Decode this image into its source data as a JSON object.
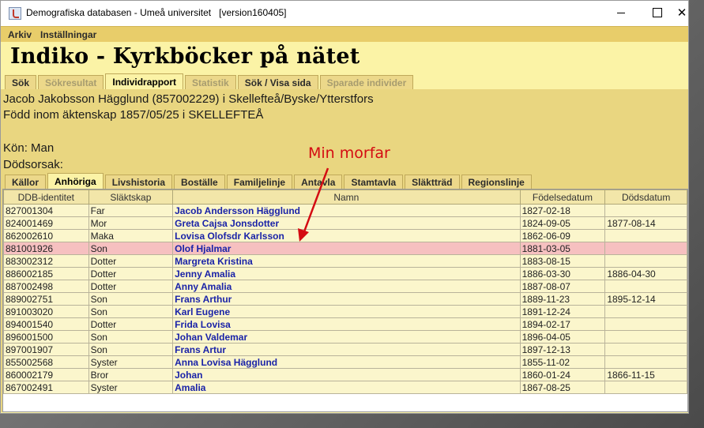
{
  "window": {
    "title": "Demografiska databasen - Umeå universitet   [version160405]"
  },
  "menu": [
    "Arkiv",
    "Inställningar"
  ],
  "banner": "Indiko - Kyrkböcker på nätet",
  "main_tabs": [
    {
      "label": "Sök",
      "state": "normal"
    },
    {
      "label": "Sökresultat",
      "state": "disabled"
    },
    {
      "label": "Individrapport",
      "state": "active"
    },
    {
      "label": "Statistik",
      "state": "disabled"
    },
    {
      "label": "Sök / Visa sida",
      "state": "normal"
    },
    {
      "label": "Sparade individer",
      "state": "disabled"
    }
  ],
  "person": {
    "line1": "Jacob Jakobsson Hägglund (857002229) i Skellefteå/Byske/Ytterstfors",
    "line2": "Född inom äktenskap 1857/05/25 i SKELLEFTEÅ",
    "sex": "Kön: Man",
    "death_cause": "Dödsorsak:"
  },
  "sub_tabs": [
    {
      "label": "Källor",
      "state": "normal"
    },
    {
      "label": "Anhöriga",
      "state": "active"
    },
    {
      "label": "Livshistoria",
      "state": "normal"
    },
    {
      "label": "Boställe",
      "state": "normal"
    },
    {
      "label": "Familjelinje",
      "state": "normal"
    },
    {
      "label": "Antavla",
      "state": "normal"
    },
    {
      "label": "Stamtavla",
      "state": "normal"
    },
    {
      "label": "Släktträd",
      "state": "normal"
    },
    {
      "label": "Regionslinje",
      "state": "normal"
    }
  ],
  "table": {
    "headers": [
      "DDB-identitet",
      "Släktskap",
      "Namn",
      "Födelsedatum",
      "Dödsdatum"
    ],
    "rows": [
      [
        "827001304",
        "Far",
        "Jacob Andersson Hägglund",
        "1827-02-18",
        ""
      ],
      [
        "824001469",
        "Mor",
        "Greta Cajsa Jonsdotter",
        "1824-09-05",
        "1877-08-14"
      ],
      [
        "862002610",
        "Maka",
        "Lovisa Olofsdr Karlsson",
        "1862-06-09",
        ""
      ],
      [
        "881001926",
        "Son",
        "Olof Hjalmar",
        "1881-03-05",
        ""
      ],
      [
        "883002312",
        "Dotter",
        "Margreta Kristina",
        "1883-08-15",
        ""
      ],
      [
        "886002185",
        "Dotter",
        "Jenny Amalia",
        "1886-03-30",
        "1886-04-30"
      ],
      [
        "887002498",
        "Dotter",
        "Anny Amalia",
        "1887-08-07",
        ""
      ],
      [
        "889002751",
        "Son",
        "Frans Arthur",
        "1889-11-23",
        "1895-12-14"
      ],
      [
        "891003020",
        "Son",
        "Karl Eugene",
        "1891-12-24",
        ""
      ],
      [
        "894001540",
        "Dotter",
        "Frida Lovisa",
        "1894-02-17",
        ""
      ],
      [
        "896001500",
        "Son",
        "Johan Valdemar",
        "1896-04-05",
        ""
      ],
      [
        "897001907",
        "Son",
        "Frans Artur",
        "1897-12-13",
        ""
      ],
      [
        "855002568",
        "Syster",
        "Anna Lovisa Hägglund",
        "1855-11-02",
        ""
      ],
      [
        "860002179",
        "Bror",
        "Johan",
        "1860-01-24",
        "1866-11-15"
      ],
      [
        "867002491",
        "Syster",
        "Amalia",
        "1867-08-25",
        ""
      ]
    ],
    "highlighted_row": 3,
    "highlight_color": "#f6c0c0"
  },
  "annotation": {
    "text": "Min morfar",
    "color": "#d40b12"
  },
  "colors": {
    "menubar": "#e8cd6a",
    "content_bg": "#fbf3a6",
    "name_link": "#1a23a8"
  }
}
